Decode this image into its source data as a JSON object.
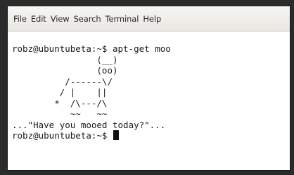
{
  "menubar": {
    "items": [
      "File",
      "Edit",
      "View",
      "Search",
      "Terminal",
      "Help"
    ]
  },
  "terminal": {
    "prompt": "robz@ubuntubeta:~$",
    "command": "apt-get moo",
    "cow_art": [
      "                (__)",
      "                (oo)",
      "          /------\\/",
      "         / |    ||",
      "        *  /\\---/\\",
      "           ~~   ~~"
    ],
    "message": "...\"Have you mooed today?\"...",
    "final_prompt": "robz@ubuntubeta:~$"
  }
}
